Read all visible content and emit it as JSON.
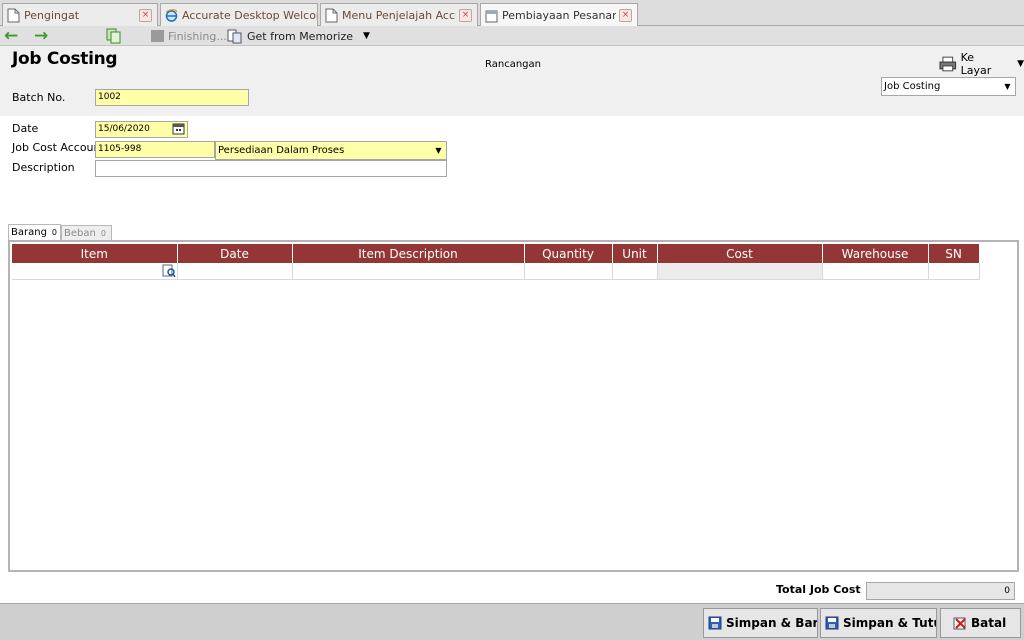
{
  "tabs": [
    {
      "label": "Pengingat"
    },
    {
      "label": "Accurate Desktop Welcome..."
    },
    {
      "label": "Menu Penjelajah Accur..."
    },
    {
      "label": "Pembiayaan Pesanan ..."
    }
  ],
  "toolbar": {
    "finishing_label": "Finishing...",
    "memorize_label": "Get from Memorize"
  },
  "form": {
    "title": "Job Costing",
    "status": "Rancangan",
    "print_label": "Ke Layar",
    "template_value": "Job Costing",
    "batch_label": "Batch No.",
    "batch_value": "1002",
    "date_label": "Date",
    "date_value": "15/06/2020",
    "account_label": "Job Cost Account",
    "account_no": "1105-998",
    "account_name": "Persediaan Dalam Proses",
    "description_label": "Description",
    "description_value": ""
  },
  "item_tabs": [
    {
      "label": "Barang",
      "count": "0"
    },
    {
      "label": "Beban",
      "count": "0"
    }
  ],
  "table": {
    "columns": [
      "Item",
      "Date",
      "Item Description",
      "Quantity",
      "Unit",
      "Cost",
      "Warehouse",
      "SN"
    ]
  },
  "footer": {
    "total_label": "Total Job Cost",
    "total_value": "0",
    "save_new_label": "Simpan & Baru",
    "save_close_label": "Simpan & Tutup",
    "cancel_label": "Batal"
  },
  "colors": {
    "header_row": "#943636",
    "required_field": "#ffffa8",
    "nav_arrows": "#3b9b2a"
  },
  "icons": [
    "document-icon",
    "ie-browser-icon",
    "calendar-icon",
    "copy-icon",
    "memorize-icon",
    "printer-icon",
    "item-lookup-icon",
    "save-icon",
    "cancel-icon"
  ]
}
